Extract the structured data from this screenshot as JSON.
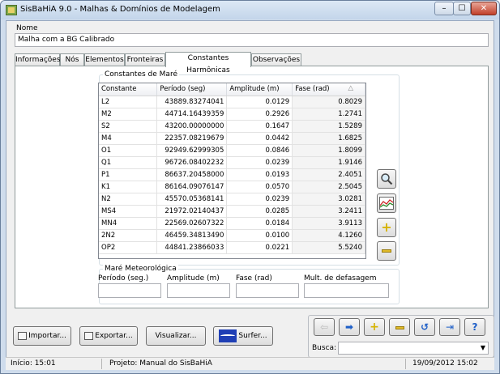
{
  "window": {
    "title": "SisBaHiA 9.0 - Malhas & Domínios de Modelagem",
    "minimize": "–",
    "maximize": "☐",
    "close": "✕"
  },
  "nome": {
    "label": "Nome",
    "value": "Malha com a BG Calibrado"
  },
  "tabs": [
    {
      "label": "Informações"
    },
    {
      "label": "Nós"
    },
    {
      "label": "Elementos"
    },
    {
      "label": "Fronteiras"
    },
    {
      "label": "Constantes Harmônicas"
    },
    {
      "label": "Observações"
    }
  ],
  "constantes": {
    "group_title": "Constantes de Maré",
    "columns": [
      "Constante",
      "Período (seg)",
      "Amplitude (m)",
      "Fase (rad)"
    ],
    "sort_glyph": "△",
    "rows": [
      [
        "L2",
        "43889.83274041",
        "0.0129",
        "0.8029"
      ],
      [
        "M2",
        "44714.16439359",
        "0.2926",
        "1.2741"
      ],
      [
        "S2",
        "43200.00000000",
        "0.1647",
        "1.5289"
      ],
      [
        "M4",
        "22357.08219679",
        "0.0442",
        "1.6825"
      ],
      [
        "O1",
        "92949.62999305",
        "0.0846",
        "1.8099"
      ],
      [
        "Q1",
        "96726.08402232",
        "0.0239",
        "1.9146"
      ],
      [
        "P1",
        "86637.20458000",
        "0.0193",
        "2.4051"
      ],
      [
        "K1",
        "86164.09076147",
        "0.0570",
        "2.5045"
      ],
      [
        "N2",
        "45570.05368141",
        "0.0239",
        "3.0281"
      ],
      [
        "MS4",
        "21972.02140437",
        "0.0285",
        "3.2411"
      ],
      [
        "MN4",
        "22569.02607322",
        "0.0184",
        "3.9113"
      ],
      [
        "2N2",
        "46459.34813490",
        "0.0100",
        "4.1260"
      ],
      [
        "OP2",
        "44841.23866033",
        "0.0221",
        "5.5240"
      ]
    ]
  },
  "meteorologica": {
    "group_title": "Maré Meteorológica",
    "periodo_label": "Período (seg.)",
    "amplitude_label": "Amplitude (m)",
    "fase_label": "Fase (rad)",
    "defasagem_label": "Mult. de defasagem"
  },
  "side_buttons": {
    "search": "🔍",
    "chart": "📈",
    "add": "+",
    "remove": "−"
  },
  "bottom_buttons": {
    "importar": "Importar...",
    "exportar": "Exportar...",
    "visualizar": "Visualizar...",
    "surfer": "Surfer..."
  },
  "nav": {
    "busca_label": "Busca:",
    "busca_value": ""
  },
  "status": {
    "inicio": "Início: 15:01",
    "projeto": "Projeto: Manual do SisBaHiA",
    "datetime": "19/09/2012 15:02"
  },
  "colors": {
    "accent_blue": "#1e5fc8",
    "add_yellow": "#f2d21d",
    "remove_yellow": "#e8c83a"
  }
}
